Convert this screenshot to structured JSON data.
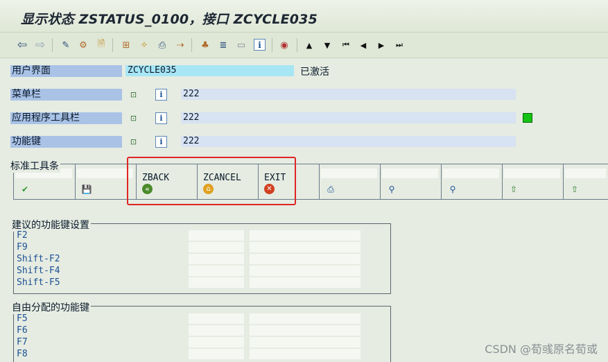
{
  "title": "显示状态 ZSTATUS_0100，接口 ZCYCLE035",
  "toolbar": {
    "icons": [
      "back-arrow-icon",
      "forward-arrow-icon",
      "display-change-icon",
      "settings-icon",
      "create-object-icon",
      "hierarchy-icon",
      "magic-wand-icon",
      "print-icon",
      "transfer-icon",
      "org-structure-icon",
      "list-icon",
      "layout-icon",
      "info-icon",
      "customize-icon",
      "first-page-icon",
      "previous-page-icon",
      "next-page-icon",
      "last-page-icon"
    ],
    "glyphs": {
      "back": "⇦",
      "forward": "⇨",
      "change": "✎",
      "settings": "⚙",
      "create": "🗎",
      "tree": "⊞",
      "wand": "✧",
      "print": "⎙",
      "move": "⇢",
      "org": "♣",
      "list": "≣",
      "window": "▭",
      "info": "i",
      "wheel": "◉",
      "up": "▲",
      "down": "▼",
      "first": "⏮",
      "prev": "◀",
      "next": "▶",
      "last": "⏭"
    }
  },
  "rows": [
    {
      "label": "用户界面",
      "value": "ZCYCLE035",
      "status": "已激活"
    },
    {
      "label": "菜单栏",
      "value": "222"
    },
    {
      "label": "应用程序工具栏",
      "value": "222"
    },
    {
      "label": "功能键",
      "value": "222"
    }
  ],
  "info_glyph": "i",
  "menu_glyph": "⊡",
  "standard_toolbar": {
    "title": "标准工具条",
    "cells": [
      {
        "code": "",
        "icon": "✔",
        "color": "#2e9a2e"
      },
      {
        "code": "",
        "icon": "💾",
        "color": "#1a5a9a"
      },
      {
        "code": "ZBACK",
        "icon": "«",
        "color": "#4a8a2a"
      },
      {
        "code": "ZCANCEL",
        "icon": "⌂",
        "color": "#e0a020"
      },
      {
        "code": "EXIT",
        "icon": "✕",
        "color": "#d04020"
      },
      {
        "code": "",
        "icon": "⎙",
        "color": "#1a4f94"
      },
      {
        "code": "",
        "icon": "⚲",
        "color": "#1a4f94"
      },
      {
        "code": "",
        "icon": "⚲",
        "color": "#1a4f94"
      },
      {
        "code": "",
        "icon": "⇧",
        "color": "#2e7a2e"
      },
      {
        "code": "",
        "icon": "⇧",
        "color": "#2e7a2e"
      }
    ]
  },
  "recommended": {
    "title": "建议的功能键设置",
    "keys": [
      "F2",
      "F9",
      "Shift-F2",
      "Shift-F4",
      "Shift-F5"
    ]
  },
  "free": {
    "title": "自由分配的功能键",
    "keys": [
      "F5",
      "F6",
      "F7",
      "F8"
    ]
  },
  "watermark": "CSDN @荀彧原名荀或"
}
